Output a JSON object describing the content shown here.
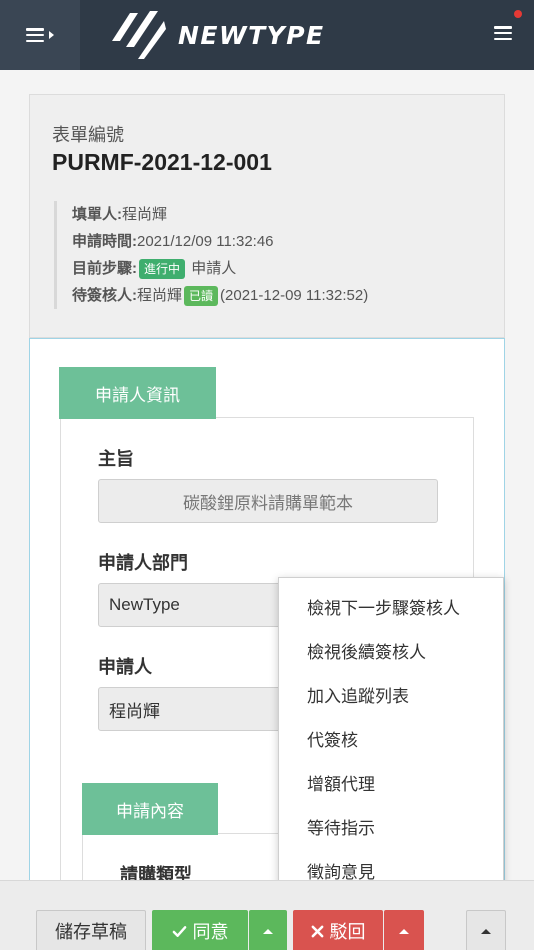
{
  "header": {
    "logo_text": "NEWTYPE"
  },
  "summary": {
    "form_no_label": "表單編號",
    "form_no": "PURMF-2021-12-001",
    "filler_label": "填單人:",
    "filler_value": "程尚輝",
    "apply_time_label": "申請時間:",
    "apply_time_value": "2021/12/09 11:32:46",
    "step_label": "目前步驟:",
    "step_badge": "進行中",
    "step_value": "申請人",
    "reviewer_label": "待簽核人:",
    "reviewer_value": "程尚輝",
    "reviewer_badge": "已讀",
    "reviewer_time": "(2021-12-09 11:32:52)"
  },
  "applicant_section": {
    "tab_label": "申請人資訊",
    "subject_label": "主旨",
    "subject_value": "碳酸鋰原料請購單範本",
    "dept_label": "申請人部門",
    "dept_value": "NewType",
    "applicant_label": "申請人",
    "applicant_value": "程尚輝"
  },
  "content_section": {
    "tab_label": "申請內容",
    "type_label": "請購類型"
  },
  "menu": {
    "items": [
      "檢視下一步驟簽核人",
      "檢視後續簽核人",
      "加入追蹤列表",
      "代簽核",
      "增額代理",
      "等待指示",
      "徵詢意見"
    ]
  },
  "toolbar": {
    "draft_label": "儲存草稿",
    "agree_label": "同意",
    "reject_label": "駁回"
  },
  "colors": {
    "header_bg": "#2f3a47",
    "accent_green": "#6dc098",
    "agree_green": "#5cb85c",
    "reject_red": "#d9534f"
  },
  "icons": [
    "sidebar-toggle-icon",
    "newtype-logo-icon",
    "menu-icon",
    "notification-dot-icon",
    "check-icon",
    "close-icon",
    "caret-up-icon"
  ]
}
